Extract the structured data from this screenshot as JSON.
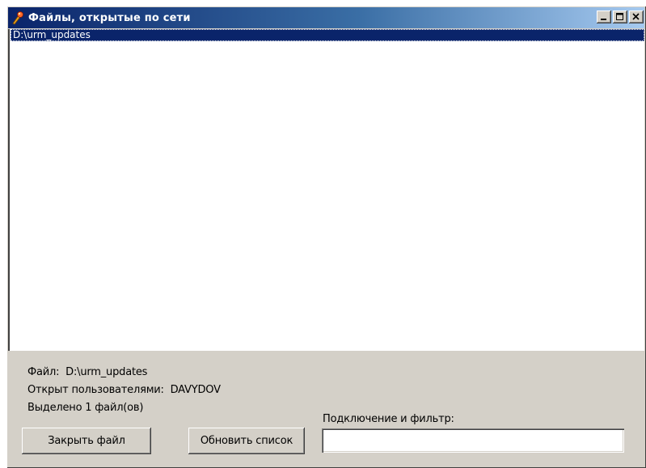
{
  "window": {
    "title": "Файлы, открытые по сети",
    "icon": "network-files-icon",
    "controls": [
      "minimize",
      "maximize",
      "close"
    ]
  },
  "list": {
    "items": [
      "D:\\urm_updates"
    ],
    "selected_index": 0
  },
  "info": {
    "file_line": "Файл:  D:\\urm_updates",
    "users_line": "Открыт пользователями:  DAVYDOV",
    "selected_line": "Выделено 1 файл(ов)"
  },
  "filter": {
    "label": "Подключение и фильтр:",
    "value": ""
  },
  "buttons": {
    "close_file": "Закрыть файл",
    "refresh": "Обновить список"
  },
  "colors": {
    "titlebar_start": "#0a246a",
    "titlebar_end": "#a6caf0",
    "selection": "#0a246a",
    "face": "#d4d0c8"
  }
}
